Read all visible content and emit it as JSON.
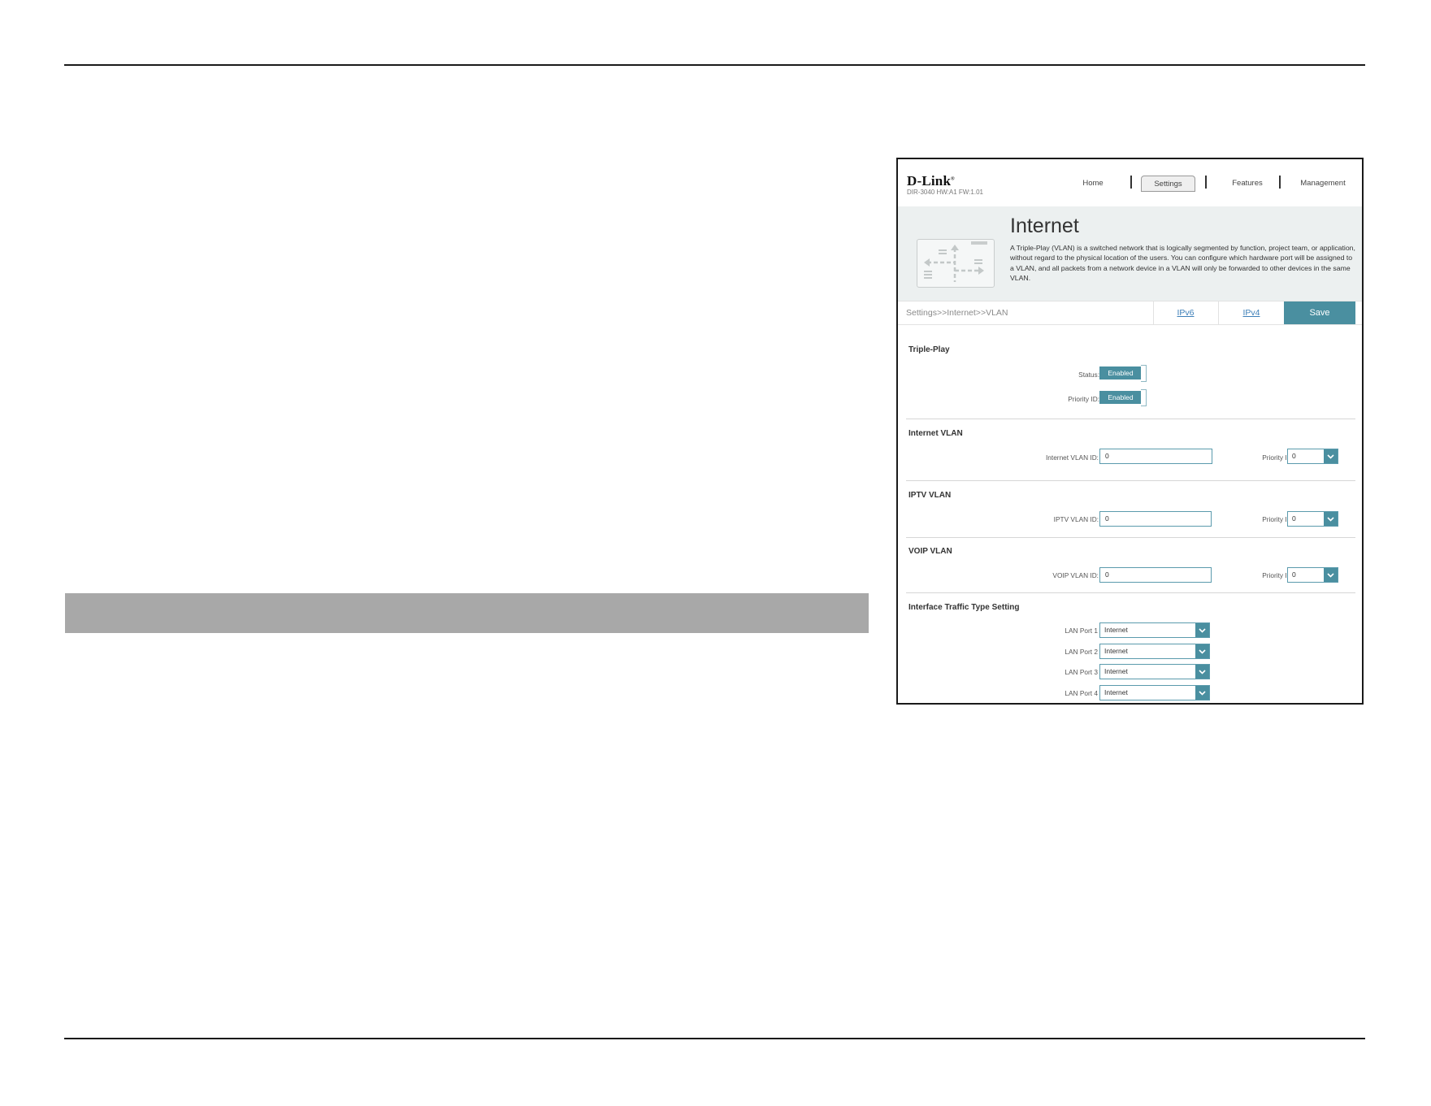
{
  "router": {
    "logo": "D-Link",
    "logo_mark": "®",
    "model": "DIR-3040 HW:A1 FW:1.01",
    "nav": [
      "Home",
      "Settings",
      "Features",
      "Management"
    ],
    "active_nav": "Settings",
    "title": "Internet",
    "description": "A Triple-Play (VLAN) is a switched network that is logically segmented by function, project team, or application, without regard to the physical location of the users. You can configure which hardware port will be assigned to a VLAN, and all packets from a network device in a VLAN will only be forwarded to other devices in the same VLAN.",
    "breadcrumb": "Settings>>Internet>>VLAN",
    "tab_ipv6": "IPv6",
    "tab_ipv4": "IPv4",
    "save_label": "Save",
    "accent_color": "#4a8fa0",
    "triple_play": {
      "heading": "Triple-Play",
      "status_label": "Status:",
      "status_value": "Enabled",
      "priority_label": "Priority ID:",
      "priority_value": "Enabled"
    },
    "internet_vlan": {
      "heading": "Internet VLAN",
      "id_label": "Internet VLAN ID:",
      "id_value": "0",
      "priority_label": "Priority ID:",
      "priority_value": "0"
    },
    "iptv_vlan": {
      "heading": "IPTV VLAN",
      "id_label": "IPTV VLAN ID:",
      "id_value": "0",
      "priority_label": "Priority ID:",
      "priority_value": "0"
    },
    "voip_vlan": {
      "heading": "VOIP VLAN",
      "id_label": "VOIP VLAN ID:",
      "id_value": "0",
      "priority_label": "Priority ID:",
      "priority_value": "0"
    },
    "interface": {
      "heading": "Interface Traffic Type Setting",
      "ports": [
        {
          "label": "LAN Port 1",
          "value": "Internet"
        },
        {
          "label": "LAN Port 2",
          "value": "Internet"
        },
        {
          "label": "LAN Port 3",
          "value": "Internet"
        },
        {
          "label": "LAN Port 4",
          "value": "Internet"
        }
      ]
    }
  }
}
